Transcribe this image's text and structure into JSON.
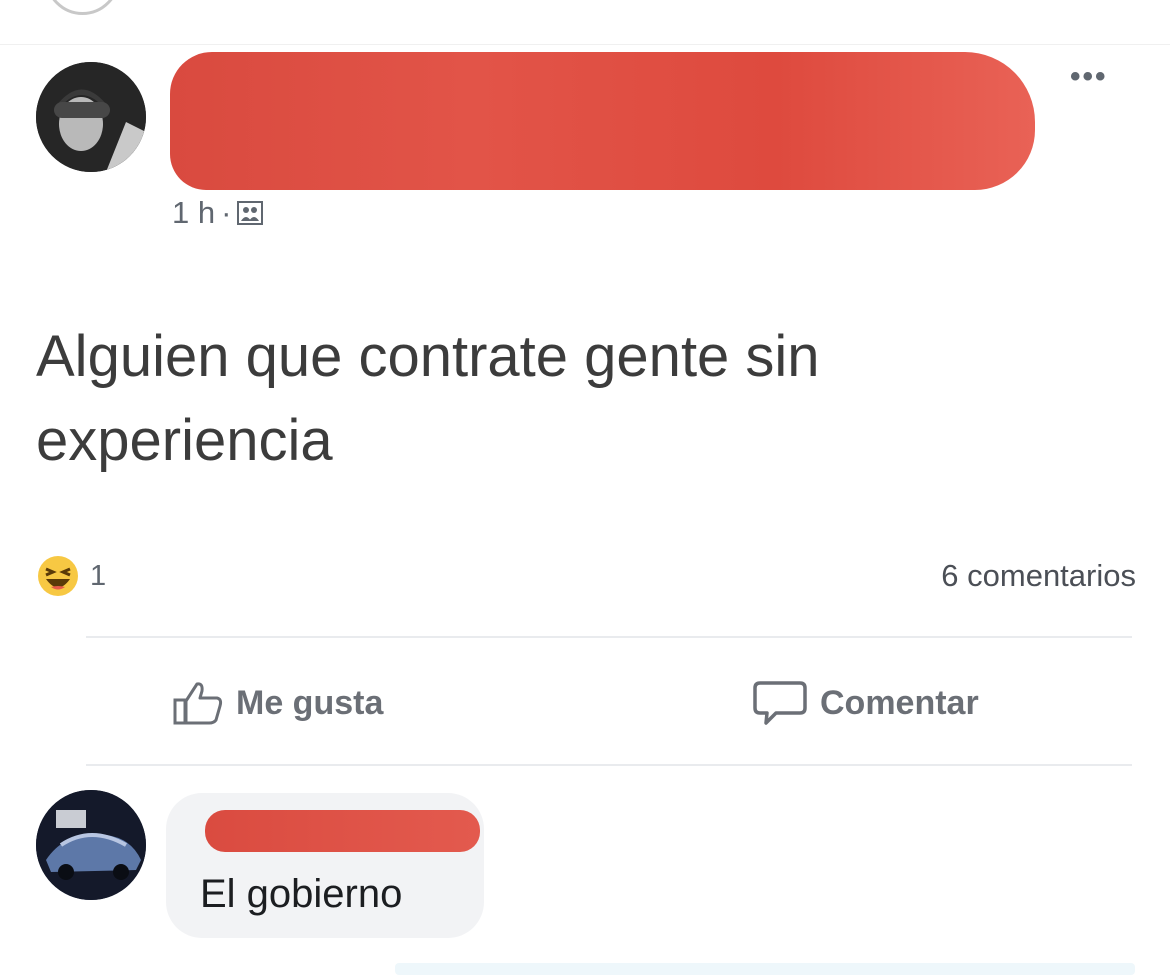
{
  "post": {
    "timestamp": "1 h",
    "separator": "·",
    "audience_icon": "friends-icon",
    "more_label": "•••",
    "text": "Alguien que contrate gente sin experiencia"
  },
  "reactions": {
    "icon": "haha-reaction-icon",
    "count": "1",
    "comments_label": "6 comentarios"
  },
  "actions": {
    "like_label": "Me gusta",
    "like_icon": "thumbs-up-icon",
    "comment_label": "Comentar",
    "comment_icon": "comment-bubble-icon"
  },
  "comment": {
    "text": "El gobierno"
  },
  "colors": {
    "redaction": "#e04f43",
    "bubble": "#f2f3f5",
    "secondary_text": "#606770"
  }
}
